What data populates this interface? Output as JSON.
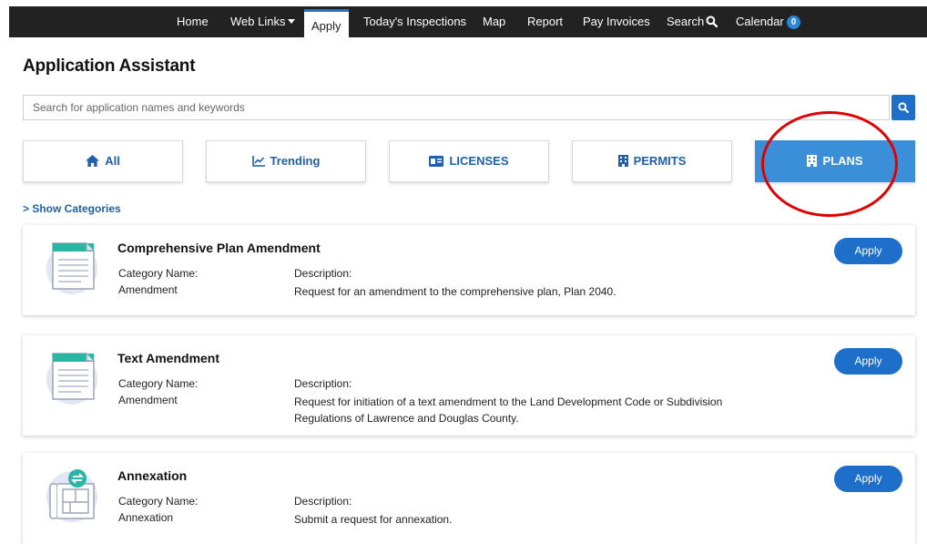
{
  "nav": {
    "items": [
      {
        "label": "Home"
      },
      {
        "label": "Web Links"
      },
      {
        "label": "Apply"
      },
      {
        "label": "Today's Inspections"
      },
      {
        "label": "Map"
      },
      {
        "label": "Report"
      },
      {
        "label": "Pay Invoices"
      },
      {
        "label": "Search"
      },
      {
        "label": "Calendar"
      }
    ],
    "calendar_count": "0",
    "active": "Apply"
  },
  "page": {
    "title": "Application Assistant"
  },
  "search": {
    "placeholder": "Search for application names and keywords",
    "value": ""
  },
  "tabs": [
    {
      "label": "All",
      "icon": "home-icon"
    },
    {
      "label": "Trending",
      "icon": "chart-line-icon"
    },
    {
      "label": "LICENSES",
      "icon": "id-card-icon"
    },
    {
      "label": "PERMITS",
      "icon": "building-icon"
    },
    {
      "label": "PLANS",
      "icon": "building-icon",
      "selected": true
    }
  ],
  "show_categories": "> Show Categories",
  "labels": {
    "category": "Category Name:",
    "description": "Description:",
    "apply": "Apply"
  },
  "applications": [
    {
      "title": "Comprehensive Plan Amendment",
      "category": "Amendment",
      "description": "Request for an amendment to the comprehensive plan, Plan 2040.",
      "icon": "document-icon"
    },
    {
      "title": "Text Amendment",
      "category": "Amendment",
      "description": "Request for initiation of a text amendment to the Land Development Code or Subdivision Regulations of Lawrence and Douglas County.",
      "icon": "document-icon"
    },
    {
      "title": "Annexation",
      "category": "Annexation",
      "description": "Submit a request for annexation.",
      "icon": "blueprint-icon"
    }
  ],
  "colors": {
    "primary": "#1e6fc9",
    "selected_tab": "#3b8fd9",
    "nav_bg": "#222222",
    "annotation": "#e00000"
  }
}
